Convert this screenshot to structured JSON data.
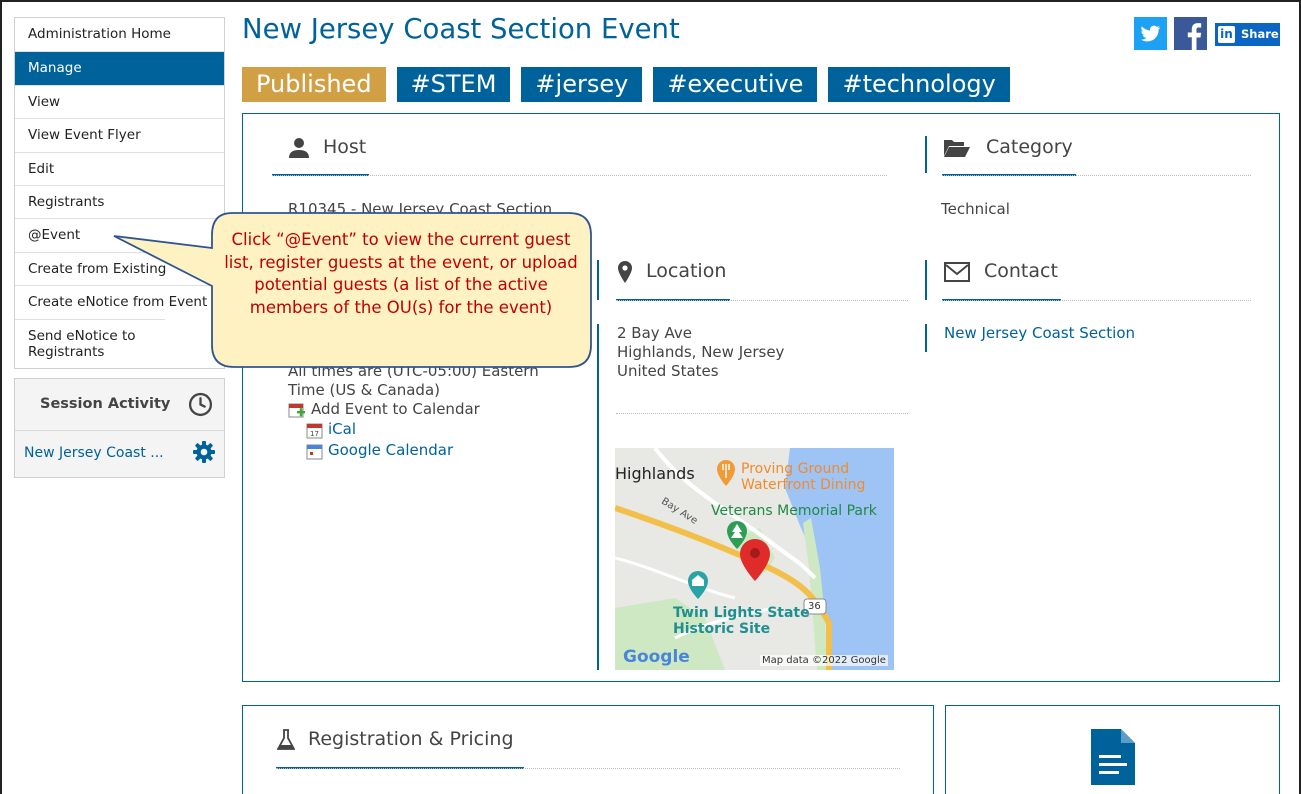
{
  "sidebar": {
    "items": [
      {
        "label": "Administration Home"
      },
      {
        "label": "Manage"
      },
      {
        "label": "View"
      },
      {
        "label": "View Event Flyer"
      },
      {
        "label": "Edit"
      },
      {
        "label": "Registrants"
      },
      {
        "label": "@Event"
      },
      {
        "label": "Create from Existing"
      },
      {
        "label": "Create eNotice from Event"
      },
      {
        "label": "Send eNotice to Registrants"
      }
    ],
    "active_index": 1
  },
  "session": {
    "title": "Session Activity",
    "link": "New Jersey Coast ...",
    "icons": {
      "clock": "clock-icon",
      "gear": "gear-icon"
    }
  },
  "event": {
    "title": "New Jersey Coast Section Event",
    "status": "Published",
    "tags": [
      "#STEM",
      "#jersey",
      "#executive",
      "#technology"
    ]
  },
  "social": {
    "share_label": "Share",
    "linkedin_glyph": "in"
  },
  "host": {
    "heading": "Host",
    "value_partial": "R10345 - New Jersey Coast Section"
  },
  "category": {
    "heading": "Category",
    "value": "Technical"
  },
  "location": {
    "heading": "Location",
    "address_line1": "2 Bay Ave",
    "address_line2": "Highlands, New Jersey",
    "address_line3": "United States"
  },
  "contact": {
    "heading": "Contact",
    "name": "New Jersey Coast Section"
  },
  "datetime": {
    "tz_line1": "All times are (UTC-05:00) Eastern",
    "tz_line2": "Time (US & Canada)",
    "add_calendar": "Add Event to Calendar",
    "ical": "iCal",
    "gcal": "Google Calendar"
  },
  "map": {
    "labels": {
      "town": "Highlands",
      "street": "Bay Ave",
      "poi1_line1": "Proving Ground",
      "poi1_line2": "Waterfront Dining",
      "park": "Veterans Memorial Park",
      "poi2_line1": "Twin Lights State",
      "poi2_line2": "Historic Site",
      "route": "36"
    },
    "logo": "Google",
    "attribution": "Map data ©2022 Google"
  },
  "callout": {
    "text": "Click “@Event” to view the current guest list, register guests at the event, or upload potential guests (a list of the active members of the OU(s) for the event)"
  },
  "registration": {
    "heading": "Registration & Pricing"
  }
}
